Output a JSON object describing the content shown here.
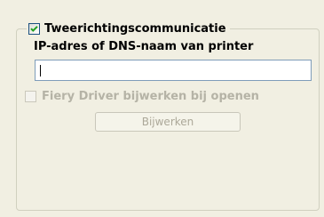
{
  "group": {
    "checkbox_label": "Tweerichtingscommunicatie",
    "checkbox_checked": true,
    "address_label": "IP-adres of DNS-naam van printer",
    "address_value": "",
    "update_checkbox_label": "Fiery Driver bijwerken bij openen",
    "update_checkbox_checked": false,
    "update_checkbox_enabled": false,
    "update_button_label": "Bijwerken",
    "update_button_enabled": false
  },
  "colors": {
    "background": "#f1efe2",
    "check_mark": "#21a121",
    "disabled_text": "#b5b3a6",
    "textbox_border": "#7f9db9"
  }
}
